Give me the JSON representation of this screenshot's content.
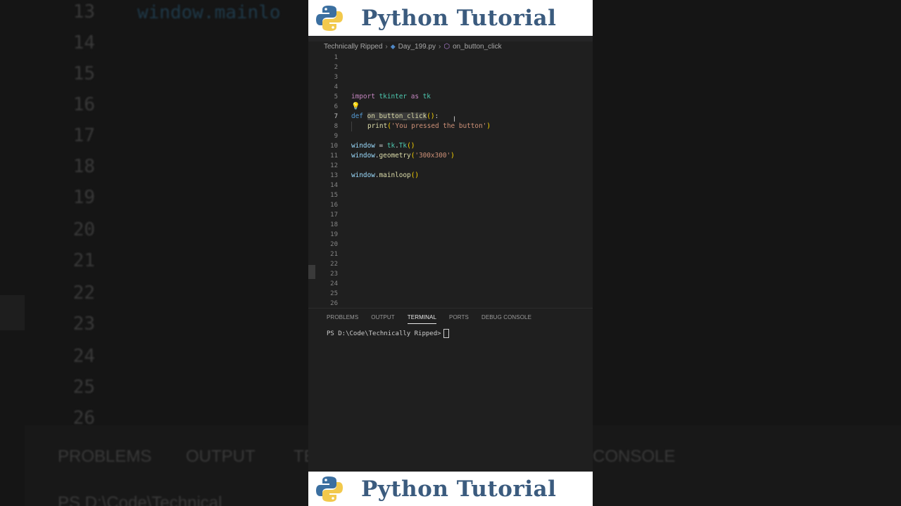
{
  "banner": {
    "title": "Python Tutorial",
    "logo_icon": "python-logo-icon"
  },
  "background": {
    "line_numbers": [
      "13",
      "14",
      "15",
      "16",
      "17",
      "18",
      "19",
      "20",
      "21",
      "22",
      "23",
      "24",
      "25",
      "26"
    ],
    "code_snippet": "window.mainlo",
    "tabs": [
      "PROBLEMS",
      "OUTPUT",
      "TE",
      "CONSOLE"
    ],
    "terminal_fragment": "PS D:\\Code\\Technical"
  },
  "editor": {
    "breadcrumb": {
      "folder": "Technically Ripped",
      "file": "Day_199.py",
      "symbol": "on_button_click"
    },
    "active_line": 7,
    "line_numbers": [
      "1",
      "2",
      "3",
      "4",
      "5",
      "6",
      "7",
      "8",
      "9",
      "10",
      "11",
      "12",
      "13",
      "14",
      "15",
      "16",
      "17",
      "18",
      "19",
      "20",
      "21",
      "22",
      "23",
      "24",
      "25",
      "26"
    ],
    "code": {
      "l5": {
        "kw": "import",
        "mod": "tkinter",
        "as": "as",
        "alias": "tk"
      },
      "l7": {
        "kw": "def",
        "fn": "on_button_click",
        "paren": "()",
        "colon": ":"
      },
      "l8": {
        "fn": "print",
        "open": "(",
        "str": "'You pressed the button'",
        "close": ")"
      },
      "l10": {
        "var": "window",
        "eq": " = ",
        "mod": "tk",
        "dot": ".",
        "cls": "Tk",
        "paren": "()"
      },
      "l11": {
        "var": "window",
        "dot": ".",
        "fn": "geometry",
        "open": "(",
        "str": "'300x300'",
        "close": ")"
      },
      "l13": {
        "var": "window",
        "dot": ".",
        "fn": "mainloop",
        "paren": "()"
      }
    }
  },
  "panel": {
    "tabs": [
      "PROBLEMS",
      "OUTPUT",
      "TERMINAL",
      "PORTS",
      "DEBUG CONSOLE"
    ],
    "active_tab": "TERMINAL",
    "prompt": "PS D:\\Code\\Technically Ripped>"
  },
  "colors": {
    "banner_text": "#3b5b7e",
    "editor_bg": "#1f1f1f",
    "keyword": "#c586c0",
    "function": "#dcdcaa",
    "string": "#ce9178"
  }
}
